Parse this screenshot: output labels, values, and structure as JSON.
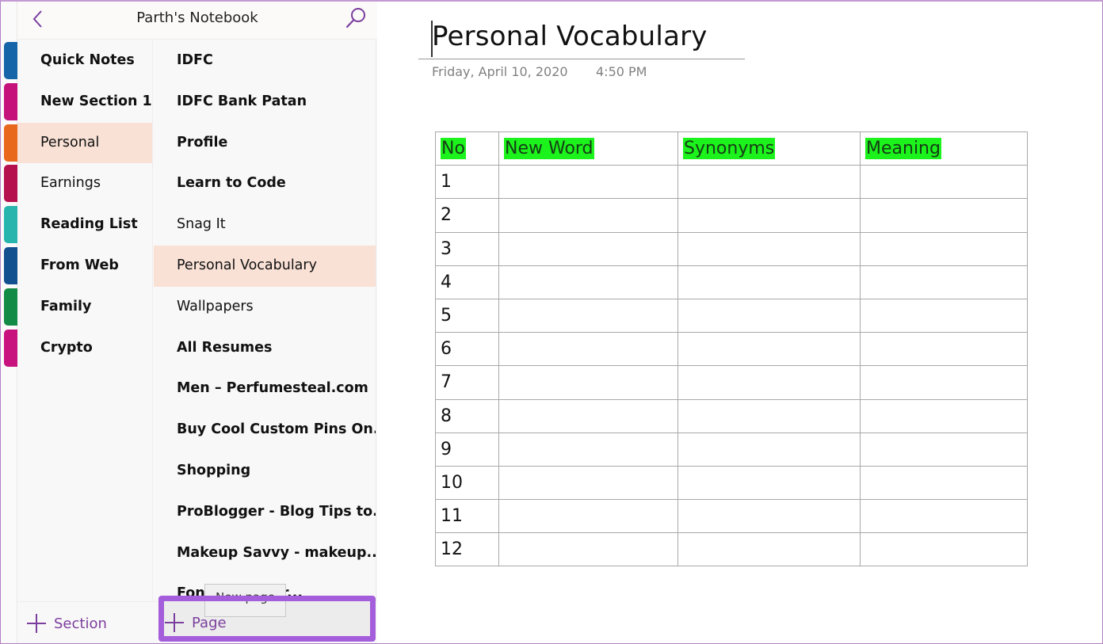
{
  "notebook": {
    "title": "Parth's Notebook",
    "back_icon": "chevron-left-icon",
    "search_icon": "search-icon"
  },
  "sections": [
    {
      "label": "Quick Notes",
      "color": "#1565a8",
      "bold": true,
      "selected": false
    },
    {
      "label": "New Section 1",
      "color": "#c5117a",
      "bold": true,
      "selected": false
    },
    {
      "label": "Personal",
      "color": "#e8691e",
      "bold": false,
      "selected": true
    },
    {
      "label": "Earnings",
      "color": "#b5114f",
      "bold": false,
      "selected": false
    },
    {
      "label": "Reading List",
      "color": "#27b5ad",
      "bold": true,
      "selected": false
    },
    {
      "label": "From Web",
      "color": "#13508f",
      "bold": true,
      "selected": false
    },
    {
      "label": "Family",
      "color": "#138a45",
      "bold": true,
      "selected": false
    },
    {
      "label": "Crypto",
      "color": "#c8137e",
      "bold": true,
      "selected": false
    }
  ],
  "pages": [
    {
      "label": "IDFC",
      "bold": true,
      "selected": false
    },
    {
      "label": "IDFC Bank Patan",
      "bold": true,
      "selected": false
    },
    {
      "label": "Profile",
      "bold": true,
      "selected": false
    },
    {
      "label": "Learn to Code",
      "bold": true,
      "selected": false
    },
    {
      "label": "Snag It",
      "bold": false,
      "selected": false
    },
    {
      "label": "Personal Vocabulary",
      "bold": false,
      "selected": true
    },
    {
      "label": "Wallpapers",
      "bold": false,
      "selected": false
    },
    {
      "label": "All Resumes",
      "bold": true,
      "selected": false
    },
    {
      "label": "Men – Perfumesteal.com",
      "bold": true,
      "selected": false
    },
    {
      "label": "Buy Cool Custom Pins On...",
      "bold": true,
      "selected": false
    },
    {
      "label": "Shopping",
      "bold": true,
      "selected": false
    },
    {
      "label": "ProBlogger - Blog Tips to...",
      "bold": true,
      "selected": false
    },
    {
      "label": "Makeup Savvy - makeup...",
      "bold": true,
      "selected": false
    },
    {
      "label": "Fonts you pair...",
      "bold": true,
      "selected": false
    }
  ],
  "footer": {
    "add_section_label": "Section",
    "add_page_label": "Page",
    "tooltip": "New page",
    "accent_color": "#7b3e9e",
    "highlight_color": "#a45ddb"
  },
  "page": {
    "title": "Personal Vocabulary",
    "date": "Friday, April 10, 2020",
    "time": "4:50 PM",
    "table": {
      "headers": [
        "No",
        "New Word",
        "Synonyms",
        "Meaning"
      ],
      "header_highlight": "#1cf21c",
      "rows": [
        [
          "1",
          "",
          "",
          ""
        ],
        [
          "2",
          "",
          "",
          ""
        ],
        [
          "3",
          "",
          "",
          ""
        ],
        [
          "4",
          "",
          "",
          ""
        ],
        [
          "5",
          "",
          "",
          ""
        ],
        [
          "6",
          "",
          "",
          ""
        ],
        [
          "7",
          "",
          "",
          ""
        ],
        [
          "8",
          "",
          "",
          ""
        ],
        [
          "9",
          "",
          "",
          ""
        ],
        [
          "10",
          "",
          "",
          ""
        ],
        [
          "11",
          "",
          "",
          ""
        ],
        [
          "12",
          "",
          "",
          ""
        ]
      ]
    }
  }
}
